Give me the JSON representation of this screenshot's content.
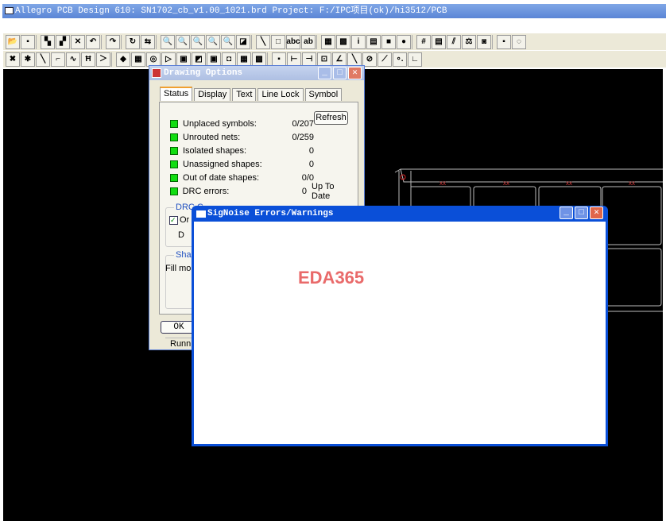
{
  "app": {
    "title": "Allegro PCB Design 610: SN1702_cb_v1.00_1021.brd  Project: F:/IPC项目(ok)/hi3512/PCB"
  },
  "toolbar": {
    "row1": [
      "open",
      "save",
      "|",
      "move",
      "copy",
      "delete",
      "undo",
      "|",
      "redo",
      "|",
      "spin",
      "mirror",
      "|",
      "zoom-points",
      "zoom-fit",
      "zoom-in",
      "zoom-out",
      "zoom-world",
      "refresh-view",
      "|",
      "add-line",
      "add-rect",
      "add-text",
      "change-text",
      "|",
      "color",
      "layers",
      "info",
      "measure",
      "highlight",
      "dehighlight",
      "|",
      "grid",
      "shapes",
      "sigxp",
      "setup",
      "viapad",
      "|",
      "net",
      "drc"
    ],
    "row2": [
      "fanout",
      "auto-route",
      "add-connect",
      "slide",
      "delay-tune",
      "spread",
      "custom-smooth",
      "|",
      "glossary",
      "place",
      "pin",
      "select",
      "snap",
      "manual",
      "swap",
      "rotate",
      "shape-edit",
      "void",
      "|",
      "etch",
      "cline",
      "gap",
      "arc",
      "chamfer",
      "miter",
      "via",
      "angle",
      "dimension",
      "fillet"
    ]
  },
  "glyphs": {
    "open": "📂",
    "save": "▪",
    "move": "▚",
    "copy": "▞",
    "delete": "✕",
    "undo": "↶",
    "redo": "↷",
    "spin": "↻",
    "mirror": "⇆",
    "zoom-points": "🔍",
    "zoom-fit": "🔍",
    "zoom-in": "🔍",
    "zoom-out": "🔍",
    "zoom-world": "🔍",
    "refresh-view": "◪",
    "add-line": "╲",
    "add-rect": "□",
    "add-text": "abc",
    "change-text": "ab",
    "color": "▦",
    "layers": "▩",
    "info": "i",
    "measure": "▤",
    "highlight": "■",
    "dehighlight": "●",
    "grid": "#",
    "shapes": "▤",
    "sigxp": "⫽",
    "setup": "⚖",
    "viapad": "◙",
    "net": "▪",
    "drc": "◌",
    "fanout": "✖",
    "auto-route": "✱",
    "add-connect": "╲",
    "slide": "⌐",
    "delay-tune": "∿",
    "spread": "Ħ",
    "custom-smooth": "＞",
    "glossary": "◆",
    "place": "▦",
    "pin": "◎",
    "select": "▷",
    "snap": "▣",
    "manual": "◩",
    "swap": "▣",
    "rotate": "◘",
    "shape-edit": "▦",
    "void": "▩",
    "etch": "▪",
    "cline": "⊢",
    "gap": "⊣",
    "arc": "⊡",
    "chamfer": "∠",
    "miter": "╲",
    "via": "⊘",
    "angle": "⟋",
    "dimension": "∘.",
    "fillet": "∟"
  },
  "drawing_options": {
    "title": "Drawing Options",
    "tabs": [
      "Status",
      "Display",
      "Text",
      "Line Lock",
      "Symbol"
    ],
    "refresh_label": "Refresh",
    "rows": [
      {
        "label": "Unplaced symbols:",
        "value": "0/207",
        "extra": ""
      },
      {
        "label": "Unrouted nets:",
        "value": "0/259",
        "extra": ""
      },
      {
        "label": "Isolated shapes:",
        "value": "0",
        "extra": ""
      },
      {
        "label": "Unassigned shapes:",
        "value": "0",
        "extra": ""
      },
      {
        "label": "Out of date shapes:",
        "value": "0/0",
        "extra": ""
      },
      {
        "label": "DRC errors:",
        "value": "0",
        "extra": "Up To Date"
      }
    ],
    "status_color": "#11dd11",
    "drc_group": "DRC C",
    "drc_check": "Or",
    "drc_d": "D",
    "shape_group": "Shap",
    "fill_mode": "Fill mo",
    "ok_label": "OK",
    "status_text": "Runnin"
  },
  "signoise": {
    "title": "SigNoise Errors/Warnings",
    "watermark": "EDA365",
    "watermark_color": "#e96a6a"
  }
}
